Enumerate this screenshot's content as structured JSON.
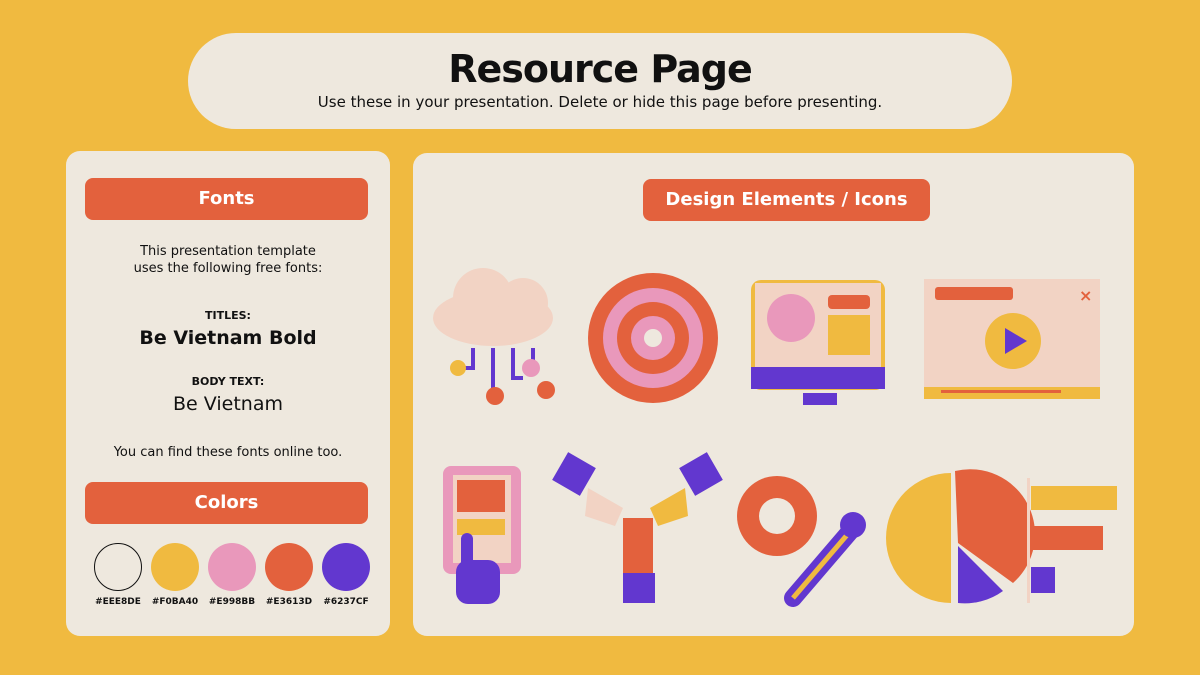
{
  "header": {
    "title": "Resource Page",
    "subtitle": "Use these in your presentation. Delete or hide this page before presenting."
  },
  "fonts": {
    "heading": "Fonts",
    "intro_line1": "This presentation template",
    "intro_line2": "uses the following free fonts:",
    "titles_label": "TITLES:",
    "titles_font": "Be Vietnam Bold",
    "body_label": "BODY TEXT:",
    "body_font": "Be Vietnam",
    "footer": "You can find these fonts online too."
  },
  "colors": {
    "heading": "Colors",
    "swatches": [
      {
        "hex": "#EEE8DE",
        "label": "#EEE8DE"
      },
      {
        "hex": "#F0BA40",
        "label": "#F0BA40"
      },
      {
        "hex": "#E998BB",
        "label": "#E998BB"
      },
      {
        "hex": "#E3613D",
        "label": "#E3613D"
      },
      {
        "hex": "#6237CF",
        "label": "#6237CF"
      }
    ]
  },
  "design": {
    "heading": "Design Elements / Icons",
    "icons": [
      "cloud-network-icon",
      "target-icon",
      "monitor-icon",
      "video-player-icon",
      "phone-touch-icon",
      "teamwork-hands-icon",
      "gear-wrench-icon",
      "pie-bar-chart-icon"
    ]
  }
}
